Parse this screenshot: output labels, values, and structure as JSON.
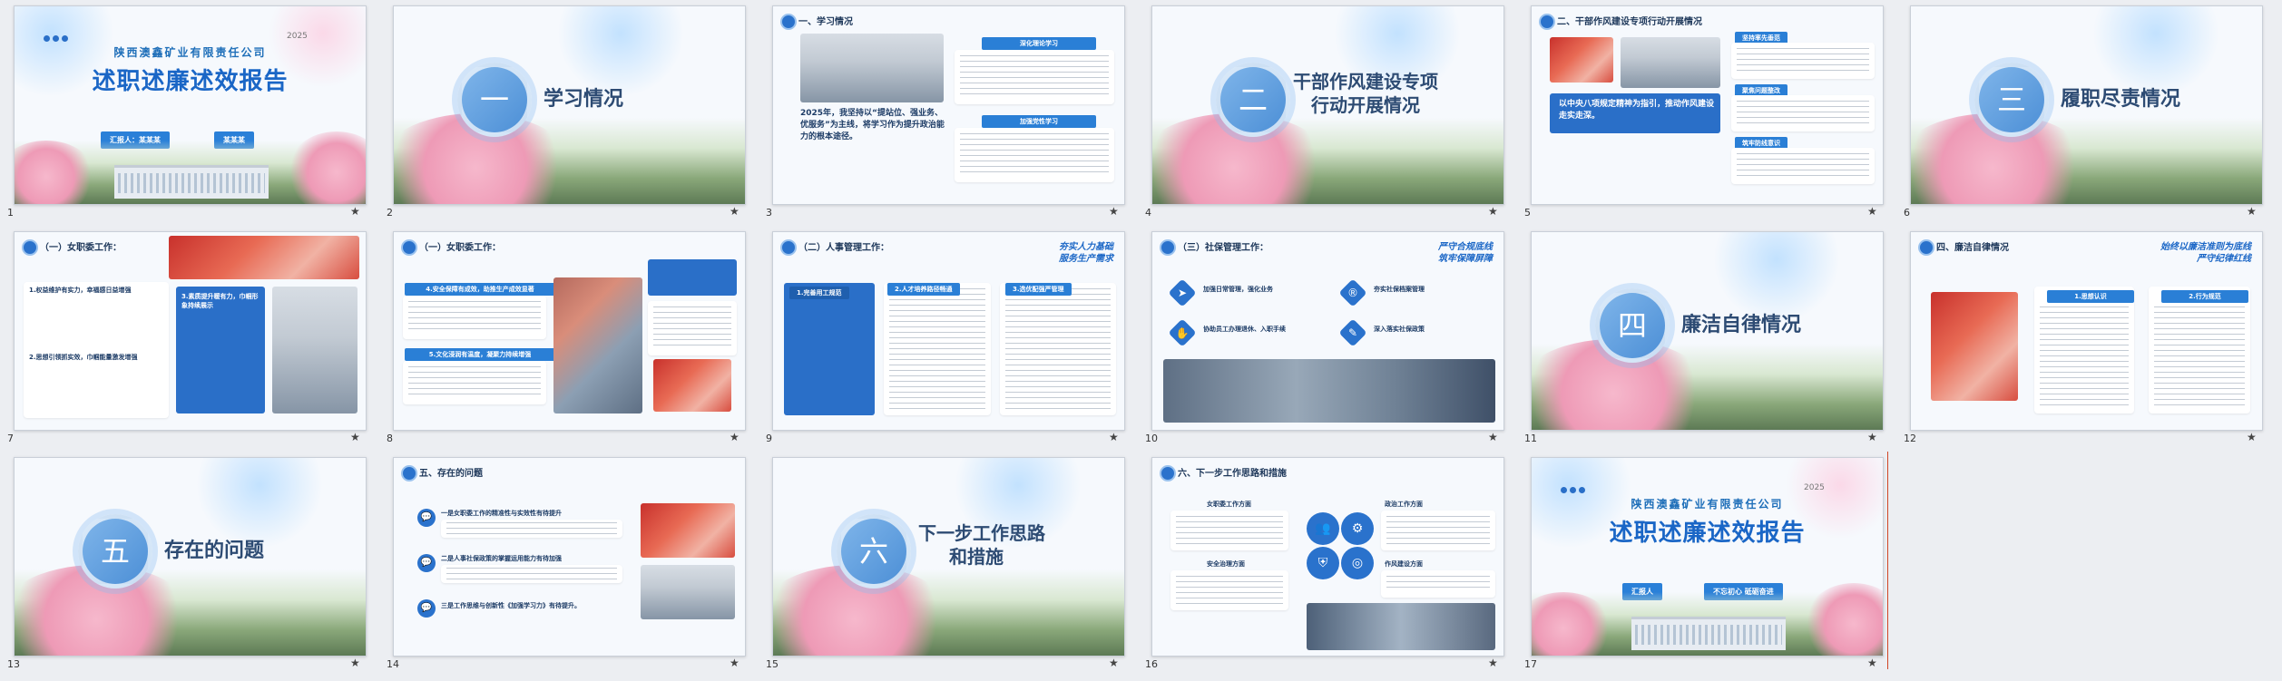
{
  "slides": [
    {
      "num": "1",
      "company": "陕西澳鑫矿业有限责任公司",
      "title": "述职述廉述效报告",
      "year": "2025",
      "pill1": "汇报人：某某某",
      "pill2": "某某某"
    },
    {
      "num": "2",
      "section": "一",
      "title": "学习情况"
    },
    {
      "num": "3",
      "header": "一、学习情况",
      "tag1": "深化理论学习",
      "tag2": "加强党性学习",
      "quote": "2025年，我坚持以“提站位、强业务、优服务”为主线，将学习作为提升政治能力的根本途径。"
    },
    {
      "num": "4",
      "section": "二",
      "title_line1": "干部作风建设专项",
      "title_line2": "行动开展情况"
    },
    {
      "num": "5",
      "header": "二、干部作风建设专项行动开展情况",
      "tag1": "坚持率先垂范",
      "tag2": "聚焦问题整改",
      "tag3": "筑牢防线意识",
      "blue_text": "以中央八项规定精神为指引，推动作风建设走实走深。"
    },
    {
      "num": "6",
      "section": "三",
      "title": "履职尽责情况"
    },
    {
      "num": "7",
      "header": "（一）女职委工作：",
      "box1": "1.权益维护有实力，幸福感日益增强",
      "box2": "2.思想引领抓实效，巾帼能量激发增强",
      "blue": "3.素质提升暖有力，巾帼形象持续展示"
    },
    {
      "num": "8",
      "header": "（一）女职委工作：",
      "tag1": "4.安全保障有成效，助推生产成效显著",
      "tag2": "5.文化浸润有温度，凝聚力持续增强"
    },
    {
      "num": "9",
      "header": "（二）人事管理工作：",
      "right1": "夯实人力基础",
      "right2": "服务生产需求",
      "tag1": "1.完善用工规范",
      "tag2": "2.人才培养路径畅通",
      "tag3": "3.选优配强严管理"
    },
    {
      "num": "10",
      "header": "（三）社保管理工作：",
      "right1": "严守合规底线",
      "right2": "筑牢保障屏障",
      "item1": "加强日常管理，强化业务",
      "item2": "协助员工办理退休、入职手续",
      "item3": "夯实社保档案管理",
      "item4": "深入落实社保政策"
    },
    {
      "num": "11",
      "section": "四",
      "title": "廉洁自律情况"
    },
    {
      "num": "12",
      "header": "四、廉洁自律情况",
      "right1": "始终以廉洁准则为底线",
      "right2": "严守纪律红线",
      "tag1": "1.思想认识",
      "tag2": "2.行为规范"
    },
    {
      "num": "13",
      "section": "五",
      "title": "存在的问题"
    },
    {
      "num": "14",
      "header": "五、存在的问题",
      "item1": "一是女职委工作的精准性与实效性有待提升",
      "item2": "二是人事社保政策的掌握运用能力有待加强",
      "item3": "三是工作思维与创新性《加强学习力》有待提升。"
    },
    {
      "num": "15",
      "section": "六",
      "title_line1": "下一步工作思路",
      "title_line2": "和措施"
    },
    {
      "num": "16",
      "header": "六、下一步工作思路和措施",
      "item1": "女职委工作方面",
      "item2": "政治工作方面",
      "item3": "安全治理方面",
      "item4": "作风建设方面"
    },
    {
      "num": "17",
      "company": "陕西澳鑫矿业有限责任公司",
      "title": "述职述廉述效报告",
      "year": "2025",
      "pill1": "汇报人",
      "pill2": "不忘初心 砥砺奋进"
    }
  ],
  "star": "★",
  "colors": {
    "accent": "#2a72cc",
    "title": "#1a66c6",
    "selection": "#d04525"
  }
}
